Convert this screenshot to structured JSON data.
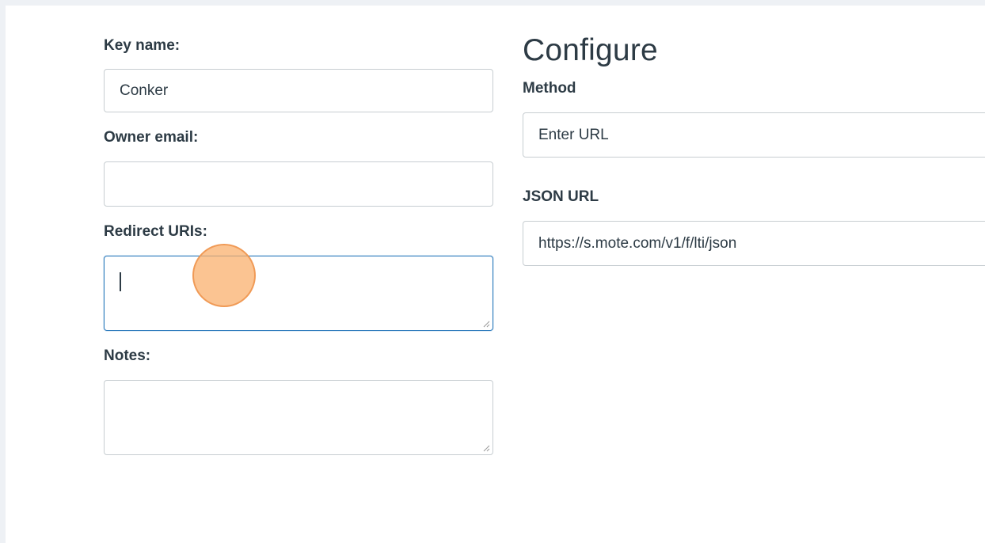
{
  "form": {
    "key_name_label": "Key name:",
    "key_name_value": "Conker",
    "owner_email_label": "Owner email:",
    "owner_email_value": "",
    "redirect_uris_label": "Redirect URIs:",
    "redirect_uris_value": "",
    "notes_label": "Notes:",
    "notes_value": ""
  },
  "configure": {
    "heading": "Configure",
    "method_label": "Method",
    "method_value": "Enter URL",
    "json_url_label": "JSON URL",
    "json_url_value": "https://s.mote.com/v1/f/lti/json"
  },
  "colors": {
    "focus_border": "#2b7abc",
    "click_indicator": "#fab06e"
  }
}
